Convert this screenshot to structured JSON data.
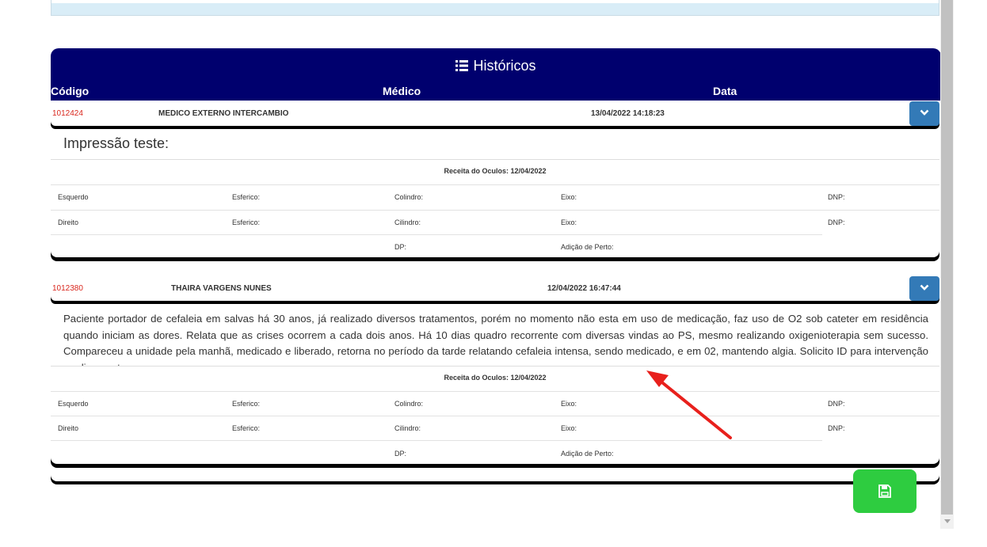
{
  "header": {
    "title": "Históricos",
    "col_code": "Código",
    "col_doctor": "Médico",
    "col_date": "Data"
  },
  "records": [
    {
      "code": "1012424",
      "doctor": "MEDICO EXTERNO INTERCAMBIO",
      "date": "13/04/2022 14:18:23",
      "note": "Impressão teste:",
      "prescription": {
        "title": "Receita do Oculos: 12/04/2022",
        "left_label": "Esquerdo",
        "right_label": "Direito",
        "spherical_left": "Esferico:",
        "spherical_right": "Esferico:",
        "cylinder_left": "Colindro:",
        "cylinder_right": "Cilindro:",
        "axis_left": "Eixo:",
        "axis_right": "Eixo:",
        "dnp_left": "DNP:",
        "dnp_right": "DNP:",
        "dp": "DP:",
        "near_add": "Adição de Perto:"
      }
    },
    {
      "code": "1012380",
      "doctor": "THAIRA VARGENS NUNES",
      "date": "12/04/2022 16:47:44",
      "note": "Paciente portador de cefaleia em salvas há 30 anos, já realizado diversos tratamentos, porém no momento não esta em uso de medicação, faz uso de O2 sob cateter em residência quando iniciam as dores. Relata que as crises ocorrem a cada dois anos. Há 10 dias quadro recorrente com diversas vindas ao PS, mesmo realizando oxigenioterapia sem sucesso. Compareceu a unidade pela manhã, medicado e liberado, retorna no período da tarde relatando cefaleia intensa, sendo medicado, e em 02, mantendo algia. Solicito ID para intervenção medicamentosa",
      "prescription": {
        "title": "Receita do Oculos: 12/04/2022",
        "left_label": "Esquerdo",
        "right_label": "Direito",
        "spherical_left": "Esferico:",
        "spherical_right": "Esferico:",
        "cylinder_left": "Colindro:",
        "cylinder_right": "Cilindro:",
        "axis_left": "Eixo:",
        "axis_right": "Eixo:",
        "dnp_left": "DNP:",
        "dnp_right": "DNP:",
        "dp": "DP:",
        "near_add": "Adição de Perto:"
      }
    }
  ],
  "icons": {
    "list": "list-icon",
    "expand": "chevron-down-icon",
    "save": "floppy-disk-icon"
  },
  "colors": {
    "header_bg": "#00006e",
    "code_text": "#d9261c",
    "expand_button": "#337ab7",
    "save_button": "#2ecc40",
    "arrow": "#e8201c"
  }
}
